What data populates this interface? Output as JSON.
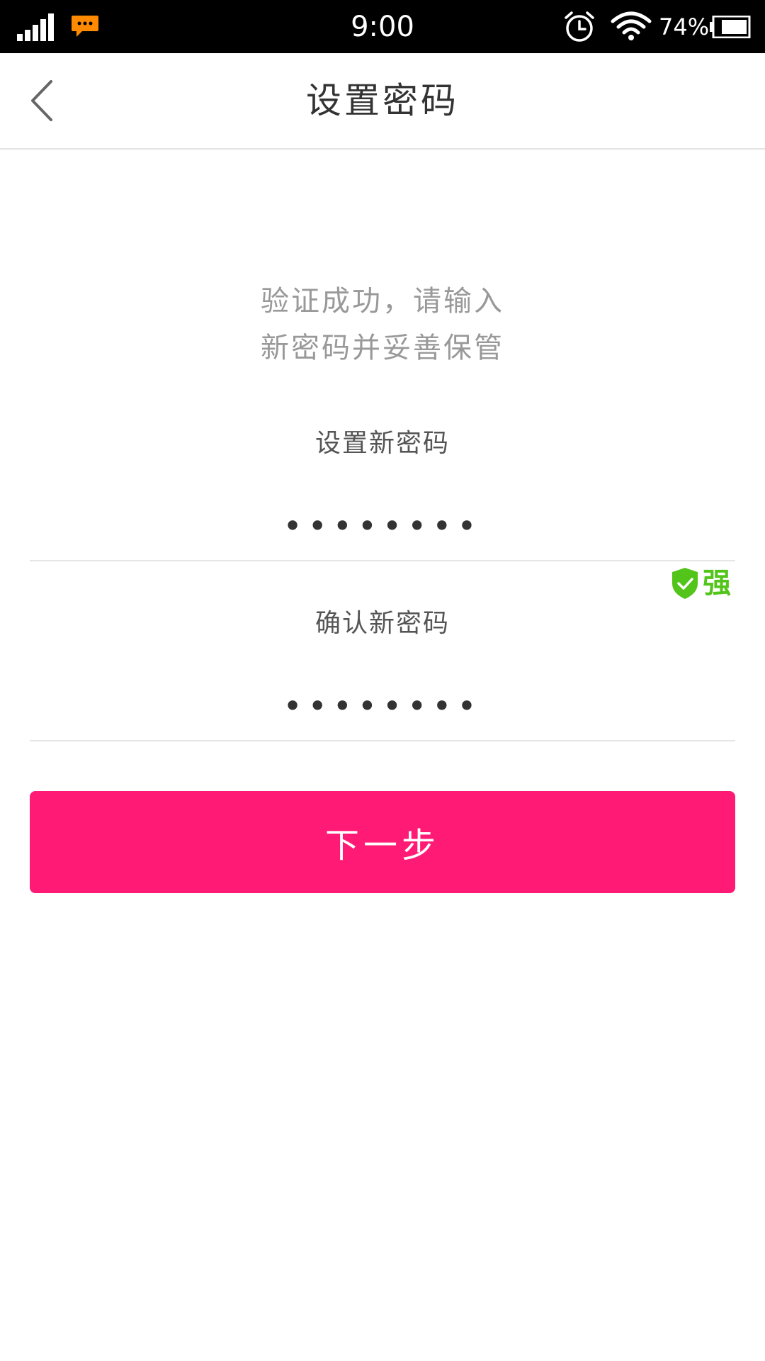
{
  "status_bar": {
    "time": "9:00",
    "battery": "74%"
  },
  "header": {
    "title": "设置密码"
  },
  "hint": "验证成功，请输入\n新密码并妥善保管",
  "form": {
    "new_password_label": "设置新密码",
    "new_password_value": "••••••••",
    "strength_label": "强",
    "confirm_password_label": "确认新密码",
    "confirm_password_value": "••••••••"
  },
  "next_button_label": "下一步",
  "colors": {
    "accent": "#ff1a75",
    "strength": "#52c41a",
    "notification": "#ff8a00"
  },
  "icons": {
    "back": "chevron-left-icon",
    "signal": "signal-icon",
    "message": "message-icon",
    "alarm": "alarm-icon",
    "wifi": "wifi-icon",
    "battery": "battery-icon",
    "strength": "shield-check-icon"
  }
}
